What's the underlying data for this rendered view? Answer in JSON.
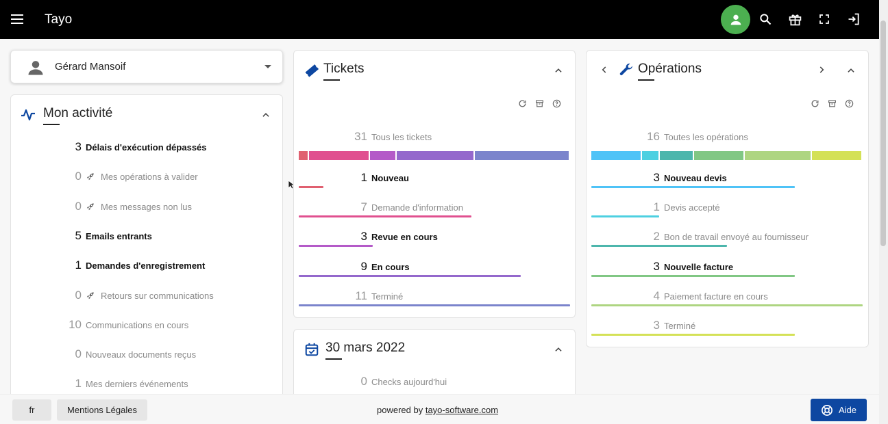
{
  "app": {
    "title": "Tayo"
  },
  "topbar": {
    "icons": [
      "menu-icon",
      "user-icon",
      "search-icon",
      "gift-icon",
      "fullscreen-icon",
      "logout-icon"
    ],
    "avatar_color": "#4caf50"
  },
  "user_select": {
    "value": "Gérard Mansoif"
  },
  "activity": {
    "title": "Mon activité",
    "items": [
      {
        "count": "3",
        "label": "Délais d'exécution dépassés",
        "emphasis": true,
        "rocket": false
      },
      {
        "count": "0",
        "label": "Mes opérations à valider",
        "emphasis": false,
        "rocket": true
      },
      {
        "count": "0",
        "label": "Mes messages non lus",
        "emphasis": false,
        "rocket": true
      },
      {
        "count": "5",
        "label": "Emails entrants",
        "emphasis": true,
        "rocket": false
      },
      {
        "count": "1",
        "label": "Demandes d'enregistrement",
        "emphasis": true,
        "rocket": false
      },
      {
        "count": "0",
        "label": "Retours sur communications",
        "emphasis": false,
        "rocket": true
      },
      {
        "count": "10",
        "label": "Communications en cours",
        "emphasis": false,
        "rocket": false
      },
      {
        "count": "0",
        "label": "Nouveaux documents reçus",
        "emphasis": false,
        "rocket": false
      },
      {
        "count": "1",
        "label": "Mes derniers événements",
        "emphasis": false,
        "rocket": false
      }
    ]
  },
  "tickets": {
    "title": "Tickets",
    "total_count": "31",
    "total_label": "Tous les tickets",
    "rows": [
      {
        "count": "1",
        "label": "Nouveau",
        "value": 1,
        "color": "#e06070",
        "emphasis": true
      },
      {
        "count": "7",
        "label": "Demande d'information",
        "value": 7,
        "color": "#e0508f",
        "emphasis": false
      },
      {
        "count": "3",
        "label": "Revue en cours",
        "value": 3,
        "color": "#b45ac8",
        "emphasis": true
      },
      {
        "count": "9",
        "label": "En cours",
        "value": 9,
        "color": "#9468cc",
        "emphasis": true
      },
      {
        "count": "11",
        "label": "Terminé",
        "value": 11,
        "color": "#7b84cc",
        "emphasis": false
      }
    ]
  },
  "calendar": {
    "title": "30 mars 2022",
    "rows": [
      {
        "count": "0",
        "label": "Checks aujourd'hui"
      }
    ]
  },
  "operations": {
    "title": "Opérations",
    "total_count": "16",
    "total_label": "Toutes les opérations",
    "rows": [
      {
        "count": "3",
        "label": "Nouveau devis",
        "value": 3,
        "color": "#4fc3f7",
        "emphasis": true
      },
      {
        "count": "1",
        "label": "Devis accepté",
        "value": 1,
        "color": "#4dd0e1",
        "emphasis": false
      },
      {
        "count": "2",
        "label": "Bon de travail envoyé au fournisseur",
        "value": 2,
        "color": "#4db6ac",
        "emphasis": false
      },
      {
        "count": "3",
        "label": "Nouvelle facture",
        "value": 3,
        "color": "#81c784",
        "emphasis": true
      },
      {
        "count": "4",
        "label": "Paiement facture en cours",
        "value": 4,
        "color": "#aed581",
        "emphasis": false
      },
      {
        "count": "3",
        "label": "Terminé",
        "value": 3,
        "color": "#d4e157",
        "emphasis": false
      }
    ]
  },
  "footer": {
    "lang": "fr",
    "legal": "Mentions Légales",
    "powered_prefix": "powered by",
    "powered_link": "tayo-software.com",
    "help": "Aide",
    "help_color": "#0d47a1"
  }
}
